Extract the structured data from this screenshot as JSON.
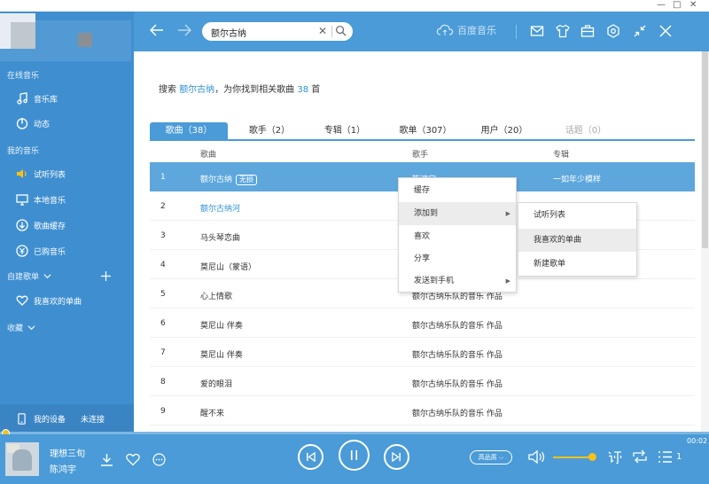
{
  "window": {
    "minimize": "—",
    "restore": "□",
    "close": "✕"
  },
  "sidebar": {
    "online_section": "在线音乐",
    "online_items": [
      {
        "label": "音乐库",
        "icon": "music-note-icon"
      },
      {
        "label": "动态",
        "icon": "dynamic-icon"
      }
    ],
    "my_section": "我的音乐",
    "my_items": [
      {
        "label": "试听列表",
        "icon": "speaker-icon"
      },
      {
        "label": "本地音乐",
        "icon": "monitor-icon"
      },
      {
        "label": "歌曲缓存",
        "icon": "download-icon"
      },
      {
        "label": "已购音乐",
        "icon": "coin-icon"
      }
    ],
    "playlist_section": "自建歌单",
    "playlist_items": [
      {
        "label": "我喜欢的单曲",
        "icon": "heart-icon"
      }
    ],
    "collect_section": "收藏",
    "device_label": "我的设备",
    "device_status": "未连接"
  },
  "header": {
    "search_value": "额尔古纳",
    "brand": "百度音乐"
  },
  "main": {
    "summary_prefix": "搜索",
    "summary_query": "额尔古纳",
    "summary_middle": "，为你找到相关歌曲",
    "summary_count": "38",
    "summary_suffix": "首",
    "tabs": [
      {
        "label": "歌曲（38）"
      },
      {
        "label": "歌手（2）"
      },
      {
        "label": "专辑（1）"
      },
      {
        "label": "歌单（307）"
      },
      {
        "label": "用户（20）"
      },
      {
        "label": "话题（0）"
      }
    ],
    "columns": {
      "song": "歌曲",
      "artist": "歌手",
      "album": "专辑"
    },
    "rows": [
      {
        "num": "1",
        "song": "额尔古纳",
        "badge": "无损",
        "artist": "陈鸿宇",
        "album": "一如年少模样"
      },
      {
        "num": "2",
        "song": "额尔古纳河",
        "artist": "",
        "album": ""
      },
      {
        "num": "3",
        "song": "马头琴恋曲",
        "artist": "",
        "album": ""
      },
      {
        "num": "4",
        "song": "莫尼山（蒙语）",
        "artist": "",
        "album": ""
      },
      {
        "num": "5",
        "song": "心上情歌",
        "artist": "额尔古纳乐队的音乐 作品",
        "album": ""
      },
      {
        "num": "6",
        "song": "莫尼山 伴奏",
        "artist": "额尔古纳乐队的音乐 作品",
        "album": ""
      },
      {
        "num": "7",
        "song": "莫尼山 伴奏",
        "artist": "额尔古纳乐队的音乐 作品",
        "album": ""
      },
      {
        "num": "8",
        "song": "爱的眼泪",
        "artist": "额尔古纳乐队的音乐 作品",
        "album": ""
      },
      {
        "num": "9",
        "song": "醒不来",
        "artist": "额尔古纳乐队的音乐 作品",
        "album": ""
      }
    ]
  },
  "context_menu": {
    "items": [
      {
        "label": "缓存"
      },
      {
        "label": "添加到",
        "submenu": true
      },
      {
        "label": "喜欢"
      },
      {
        "label": "分享"
      },
      {
        "label": "发送到手机",
        "submenu": true
      }
    ],
    "submenu_items": [
      {
        "label": "试听列表"
      },
      {
        "label": "我喜欢的单曲"
      },
      {
        "label": "新建歌单"
      }
    ]
  },
  "player": {
    "title": "理想三旬",
    "artist": "陈鸿宇",
    "quality": "高品质",
    "time": "00:02",
    "queue_count": "1",
    "progress": 0.01,
    "volume": 0.9
  },
  "colors": {
    "primary": "#4a9bd7",
    "sidebar": "#3f8fd0",
    "accent": "#f4c21a",
    "link": "#2f8fd6"
  }
}
